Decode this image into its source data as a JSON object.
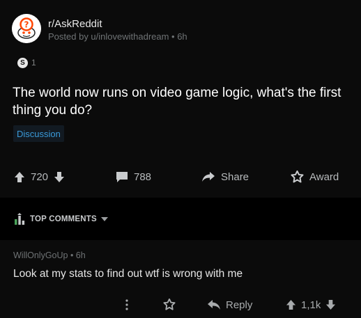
{
  "post": {
    "subreddit": "r/AskReddit",
    "posted_by": "Posted by u/inlovewithadream • 6h",
    "award_count": "1",
    "award_glyph": "S",
    "title": "The world now runs on video game logic, what's the first thing you do?",
    "flair": "Discussion",
    "votes": "720",
    "comments": "788",
    "share_label": "Share",
    "award_label": "Award"
  },
  "sort": {
    "label": "TOP COMMENTS"
  },
  "comment": {
    "author_line": "WillOnlyGoUp • 6h",
    "body": "Look at my stats to find out wtf is wrong with me",
    "reply_label": "Reply",
    "votes": "1,1k"
  },
  "colors": {
    "background": "#0b0b0b",
    "band": "#000000",
    "flair_text": "#3a9ad9",
    "muted_text": "#6f7375"
  }
}
